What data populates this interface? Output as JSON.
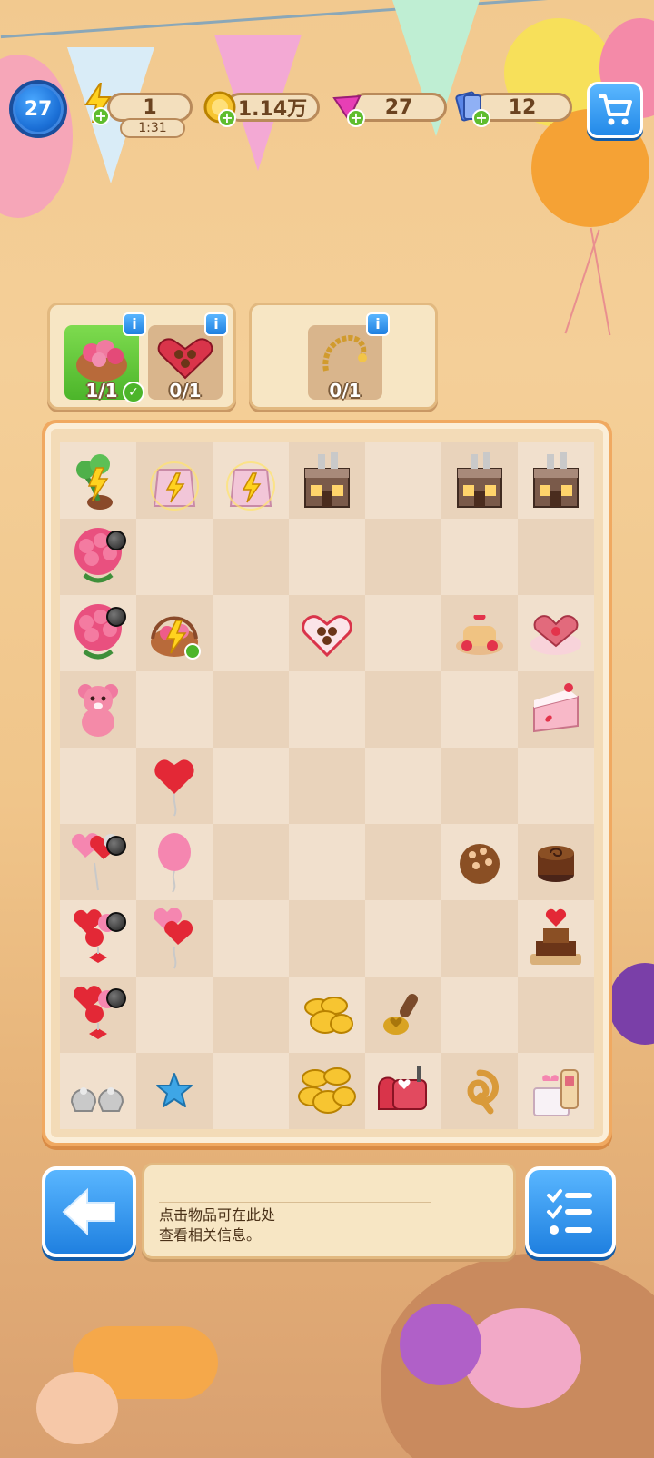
{
  "player": {
    "level": "27"
  },
  "resources": {
    "energy": {
      "value": "1",
      "timer": "1:31",
      "icon": "lightning-icon"
    },
    "coins": {
      "value": "1.14万",
      "icon": "coin-icon"
    },
    "gems": {
      "value": "27",
      "icon": "gem-icon"
    },
    "cards": {
      "value": "12",
      "icon": "card-icon"
    }
  },
  "orders": [
    {
      "slots": [
        {
          "item": "rose-basket",
          "count": "1/1",
          "done": true
        },
        {
          "item": "chocolate-box",
          "count": "0/1",
          "done": false
        }
      ]
    },
    {
      "slots": [
        {
          "item": "gold-bracelet",
          "count": "0/1",
          "done": false
        }
      ]
    }
  ],
  "info_panel": {
    "line1": "点击物品可在此处",
    "line2": "查看相关信息。"
  },
  "colors": {
    "accent_blue": "#2389e8",
    "panel_bg": "#f7e6c4",
    "board_border": "#f0a961",
    "success_green": "#4cb52a"
  },
  "board": {
    "cols": 7,
    "rows": 9,
    "items": [
      [
        "rose-bush-generator",
        "gift-bag-energy",
        "gift-bag-energy",
        "chocolate-shop",
        "",
        "chocolate-shop",
        "chocolate-shop"
      ],
      [
        "rose-bouquet-large",
        "",
        "",
        "",
        "",
        "",
        ""
      ],
      [
        "rose-bouquet-large",
        "rose-basket-energy",
        "",
        "heart-chocolate-box",
        "",
        "strawberry-cake",
        "heart-cake"
      ],
      [
        "teddy-bear",
        "",
        "",
        "",
        "",
        "",
        "cake-slice"
      ],
      [
        "",
        "heart-balloon",
        "",
        "",
        "",
        "",
        ""
      ],
      [
        "heart-balloon-bunch",
        "pink-balloon",
        "",
        "",
        "",
        "nut-truffle",
        "chocolate-roll"
      ],
      [
        "balloon-bunch-bow",
        "heart-balloon-pair",
        "",
        "",
        "",
        "",
        "tiered-chocolate-cake"
      ],
      [
        "balloon-bunch-bow",
        "",
        "",
        "gold-coins-small",
        "wax-seal-stamp",
        "",
        ""
      ],
      [
        "silver-purse-pair",
        "blue-star",
        "",
        "gold-coins-pile",
        "mailbox",
        "pretzel-ring",
        "gift-box-sweets"
      ]
    ]
  }
}
